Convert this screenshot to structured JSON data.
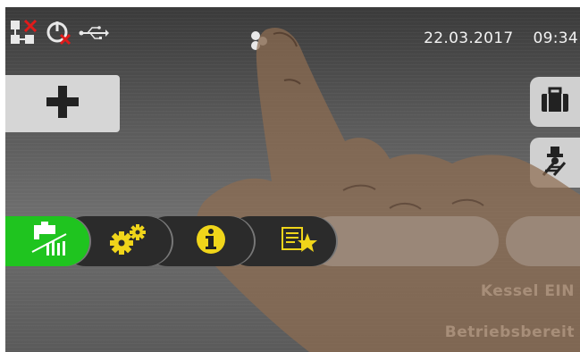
{
  "header": {
    "date": "22.03.2017",
    "time": "09:34"
  },
  "status": {
    "line1": "Kessel EIN",
    "line2": "Betriebsbereit"
  },
  "icons": {
    "network": "network-disconnected-icon",
    "power": "power-off-icon",
    "usb": "usb-icon",
    "user": "user-icon",
    "add": "plus-icon",
    "suitcase": "suitcase-icon",
    "chimney_sweep": "chimney-sweep-icon",
    "hot_water": "hot-water-tap-icon",
    "settings": "gears-icon",
    "info": "info-icon",
    "favorites": "favorites-list-icon"
  },
  "colors": {
    "active_tab": "#1fc41f",
    "icon_yellow": "#f0d51a",
    "tab_dark": "#2b2b2b",
    "button_gray": "#d6d6d6"
  }
}
